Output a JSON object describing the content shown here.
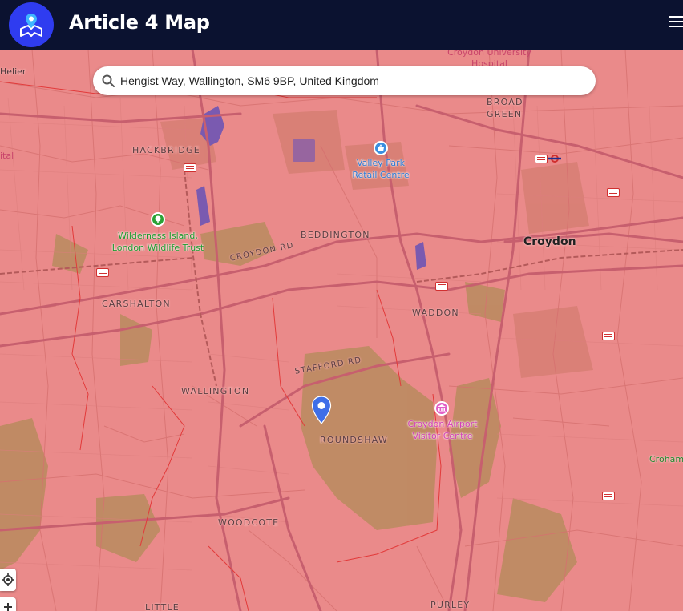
{
  "app": {
    "title": "Article 4 Map"
  },
  "search": {
    "value": "Hengist Way, Wallington, SM6 9BP, United Kingdom",
    "placeholder": ""
  },
  "map": {
    "places": {
      "hackbridge": "HACKBRIDGE",
      "beddington": "BEDDINGTON",
      "carshalton": "CARSHALTON",
      "wallington": "WALLINGTON",
      "roundshaw": "ROUNDSHAW",
      "waddon": "WADDON",
      "broad_green_1": "BROAD",
      "broad_green_2": "GREEN",
      "woodcote": "WOODCOTE",
      "purley": "PURLEY",
      "little": "LITTLE",
      "croydon": "Croydon"
    },
    "roads": {
      "croydon_rd": "CROYDON RD",
      "stafford_rd": "STAFFORD RD"
    },
    "pois": {
      "valley_park_1": "Valley Park",
      "valley_park_2": "Retail Centre",
      "wilderness_1": "Wilderness Island,",
      "wilderness_2": "London Wildlife Trust",
      "airport_1": "Croydon Airport",
      "airport_2": "Visitor Centre",
      "hospital_1": "Croydon University",
      "hospital_2": "Hospital",
      "helier": "Helier",
      "ital": "ital",
      "croham": "Croham"
    },
    "colors": {
      "article4_overlay": "#ea8a8a",
      "parks": "#b88a5c",
      "pin": "#3f6ee8",
      "header": "#0b1230",
      "logo": "#2f3cf0"
    }
  }
}
